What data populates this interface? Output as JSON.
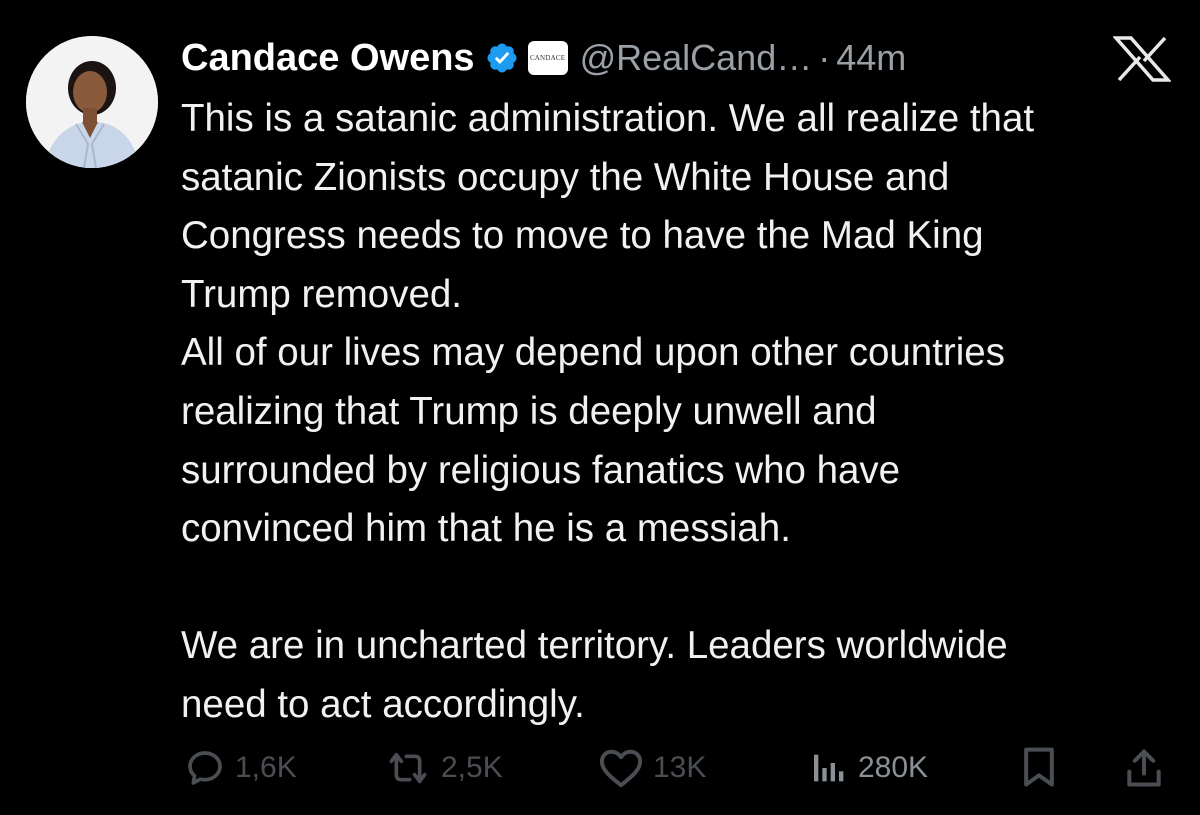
{
  "author": {
    "display_name": "Candace Owens",
    "handle": "@RealCand…",
    "separator": "·",
    "time_ago": "44m",
    "affiliate_badge_text": "CANDACE",
    "verified_color": "#1d9bf0"
  },
  "platform_logo": "X",
  "tweet": {
    "lines": [
      "This is a satanic administration. We all realize that",
      "satanic Zionists occupy the White House and",
      "Congress needs to move to have the Mad King",
      "Trump removed.",
      "All of our lives may depend upon other countries",
      "realizing that Trump is deeply unwell and",
      "surrounded by religious fanatics who have",
      "convinced him that he is a messiah."
    ],
    "lines_after_break": [
      "We are in uncharted territory. Leaders worldwide",
      "need to act accordingly."
    ]
  },
  "actions": {
    "replies": "1,6K",
    "reposts": "2,5K",
    "likes": "13K",
    "views": "280K",
    "icons": [
      "reply-icon",
      "repost-icon",
      "like-icon",
      "views-icon",
      "bookmark-icon",
      "share-icon"
    ]
  },
  "colors": {
    "background": "#000000",
    "text": "#e7e9ea",
    "muted": "#9aa0a6",
    "action_dim": "#4a4d52"
  }
}
